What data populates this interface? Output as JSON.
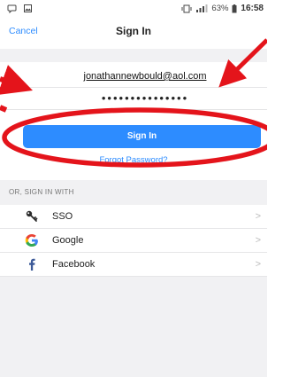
{
  "status_bar": {
    "left_icons": [
      "chat-bubble-icon",
      "gallery-icon"
    ],
    "battery_percent": "63%",
    "time": "16:58"
  },
  "nav": {
    "cancel_label": "Cancel",
    "title": "Sign In"
  },
  "form": {
    "email_value": "jonathannewbould@aol.com",
    "password_mask": "•••••••••••••••",
    "signin_label": "Sign In",
    "forgot_label": "Forgot Password?"
  },
  "alt_signin": {
    "section_label": "OR, SIGN IN WITH",
    "options": [
      {
        "label": "SSO",
        "icon": "key-icon"
      },
      {
        "label": "Google",
        "icon": "google-icon"
      },
      {
        "label": "Facebook",
        "icon": "facebook-icon"
      }
    ],
    "chevron": ">"
  },
  "colors": {
    "accent": "#2d8cff",
    "annotation_red": "#e4141b",
    "section_bg": "#f1f1f3"
  }
}
